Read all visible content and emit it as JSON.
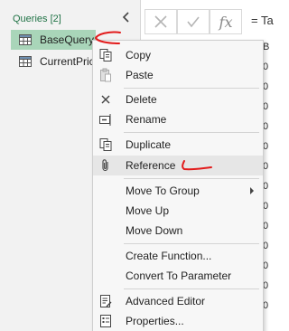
{
  "queries_pane": {
    "header": "Queries [2]",
    "items": [
      {
        "label": "BaseQuery",
        "selected": true
      },
      {
        "label": "CurrentPrice",
        "selected": false
      }
    ]
  },
  "formula_bar": {
    "formula_text": "= Ta",
    "fx_label": "fx"
  },
  "grid": {
    "cells": [
      "B",
      "0",
      "0",
      "0",
      "0",
      "0",
      "0",
      "0",
      "0",
      "0",
      "0",
      "0",
      "0",
      "0"
    ]
  },
  "context_menu": {
    "items": [
      {
        "label": "Copy",
        "icon": "copy-icon"
      },
      {
        "label": "Paste",
        "icon": "paste-icon"
      },
      {
        "label": "Delete",
        "icon": "delete-icon"
      },
      {
        "label": "Rename",
        "icon": "rename-icon"
      },
      {
        "label": "Duplicate",
        "icon": "duplicate-icon"
      },
      {
        "label": "Reference",
        "icon": "paperclip-icon",
        "highlighted": true
      },
      {
        "label": "Move To Group",
        "submenu": true
      },
      {
        "label": "Move Up"
      },
      {
        "label": "Move Down"
      },
      {
        "label": "Create Function..."
      },
      {
        "label": "Convert To Parameter"
      },
      {
        "label": "Advanced Editor",
        "icon": "advanced-editor-icon"
      },
      {
        "label": "Properties...",
        "icon": "properties-icon"
      }
    ]
  },
  "colors": {
    "selected_query_bg": "#a9d5b9",
    "header_green": "#217346",
    "annotation_red": "#e21b1b"
  }
}
